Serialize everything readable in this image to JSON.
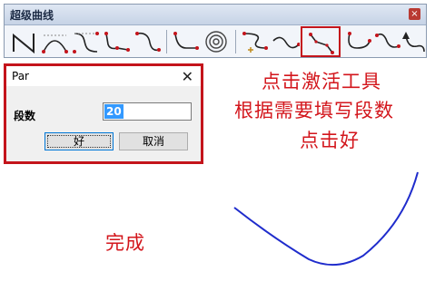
{
  "toolbar": {
    "title": "超级曲线",
    "close_glyph": "×",
    "tools": [
      "line-tool-icon",
      "arc-tool-icon",
      "bezier-tool-icon",
      "polyline-curve-icon",
      "smooth-curve-icon",
      "corner-curve-icon",
      "concentric-circle-icon",
      "point-curve-icon",
      "wave-curve-icon",
      "segment-curve-icon",
      "hook-curve-icon",
      "s-curve-icon",
      "arrow-curve-icon"
    ]
  },
  "dialog": {
    "title": "Par",
    "close_glyph": "✕",
    "field_label": "段数",
    "field_value": "20",
    "ok_label": "好",
    "cancel_label": "取消"
  },
  "annotations": {
    "line1": "点击激活工具",
    "line2": "根据需要填写段数",
    "line3": "点击好",
    "done": "完成"
  },
  "colors": {
    "highlight": "#c4141b",
    "curve": "#1f2ccc",
    "selection": "#3399ff"
  }
}
